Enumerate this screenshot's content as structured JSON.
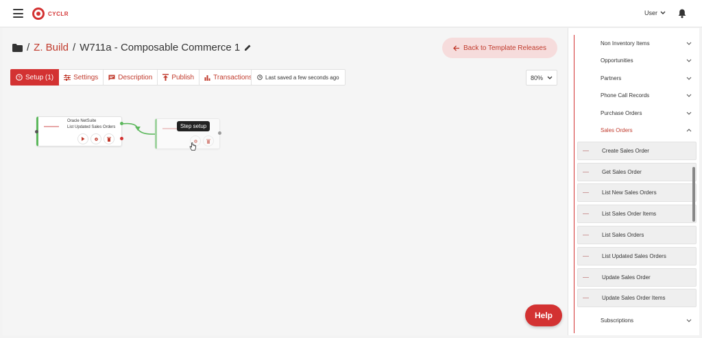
{
  "header": {
    "logo_text": "CYCLR",
    "user_label": "User"
  },
  "breadcrumb": {
    "separator": "/",
    "folder": "Z. Build",
    "title": "W711a - Composable Commerce 1"
  },
  "back_button": "Back to Template Releases",
  "tabs": [
    {
      "label": "Setup (1)",
      "icon": "help-circle-icon"
    },
    {
      "label": "Settings",
      "icon": "sliders-icon"
    },
    {
      "label": "Description",
      "icon": "comment-icon"
    },
    {
      "label": "Publish",
      "icon": "upload-icon"
    },
    {
      "label": "Transactions",
      "icon": "bar-chart-icon"
    }
  ],
  "saved_status": "Last saved a few seconds ago",
  "zoom": "80%",
  "steps": [
    {
      "connector": "Oracle NetSuite",
      "action": "List Updated Sales Orders"
    }
  ],
  "tooltip": "Step setup",
  "help_button": "Help",
  "sidebar": {
    "categories_top": [
      {
        "label": "Non Inventory Items"
      },
      {
        "label": "Opportunities"
      },
      {
        "label": "Partners"
      },
      {
        "label": "Phone Call Records"
      },
      {
        "label": "Purchase Orders"
      },
      {
        "label": "Sales Orders"
      }
    ],
    "actions": [
      {
        "label": "Create Sales Order"
      },
      {
        "label": "Get Sales Order"
      },
      {
        "label": "List New Sales Orders"
      },
      {
        "label": "List Sales Order Items"
      },
      {
        "label": "List Sales Orders"
      },
      {
        "label": "List Updated Sales Orders"
      },
      {
        "label": "Update Sales Order"
      },
      {
        "label": "Update Sales Order Items"
      }
    ],
    "categories_bottom": [
      {
        "label": "Subscriptions"
      }
    ]
  },
  "colors": {
    "brand": "#d33232",
    "connector_green": "#5cb85c"
  }
}
